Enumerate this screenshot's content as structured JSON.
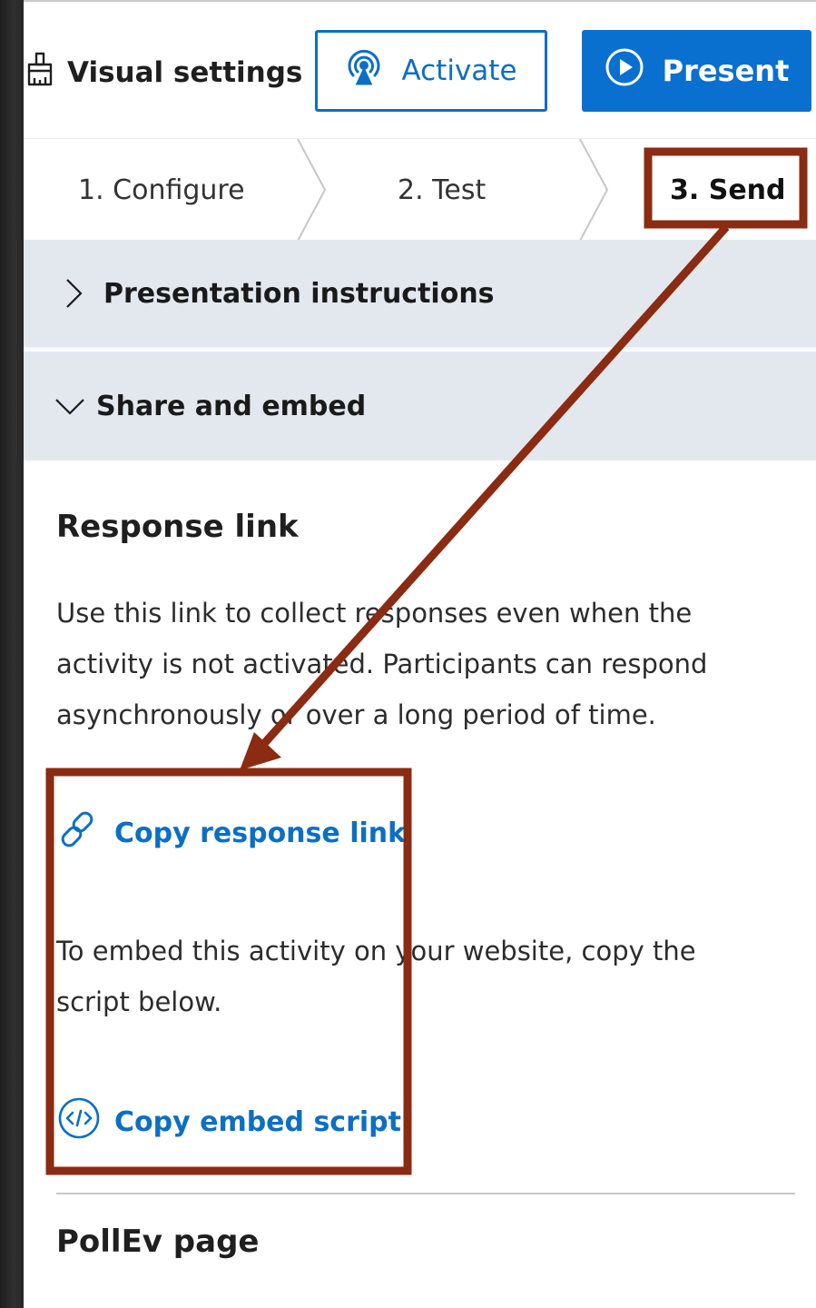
{
  "toolbar": {
    "visual_settings_label": "Visual settings",
    "activate_label": "Activate",
    "present_label": "Present"
  },
  "steps": [
    {
      "label": "1. Configure"
    },
    {
      "label": "2. Test"
    },
    {
      "label": "3. Send",
      "active": true
    }
  ],
  "accordions": {
    "presentation_instructions": {
      "title": "Presentation instructions",
      "expanded": false
    },
    "share_and_embed": {
      "title": "Share and embed",
      "expanded": true
    }
  },
  "response_link": {
    "heading": "Response link",
    "description": "Use this link to collect responses even when the activity is not activated. Participants can respond asynchronously or over a long period of time.",
    "copy_link_label": "Copy response link",
    "embed_description": "To embed this activity on your website, copy the script below.",
    "copy_embed_label": "Copy embed script"
  },
  "pollev_page": {
    "heading": "PollEv page"
  },
  "icons": {
    "visual_settings": "paint-brush-icon",
    "activate": "broadcast-icon",
    "present": "play-circle-icon",
    "collapsed": "chevron-right-icon",
    "expanded": "chevron-down-icon",
    "copy_link": "link-icon",
    "copy_embed": "code-icon"
  },
  "colors": {
    "accent": "#0b6fc6",
    "present_bg": "#0a70cf",
    "accordion_bg": "#e3e8ef",
    "annotation": "#8a2b12"
  }
}
